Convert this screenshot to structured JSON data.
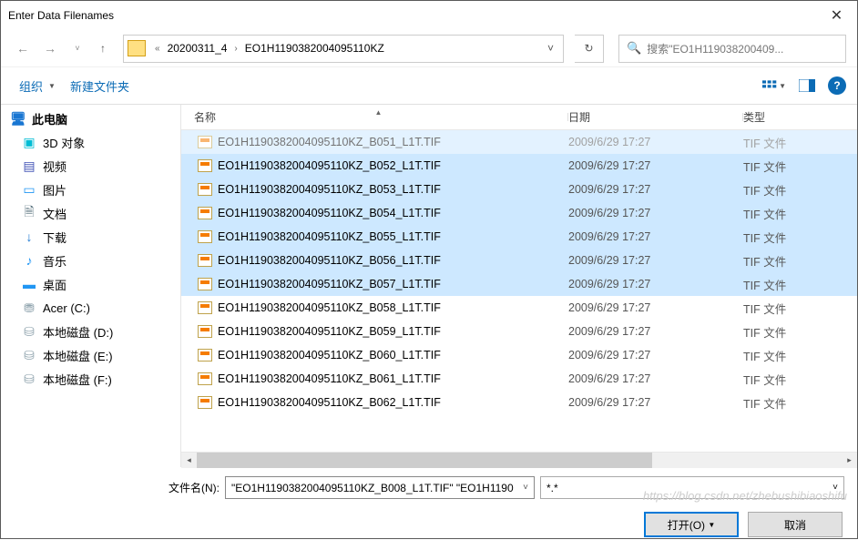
{
  "title": "Enter Data Filenames",
  "breadcrumb": {
    "pre": "«",
    "seg1": "20200311_4",
    "seg2": "EO1H1190382004095110KZ"
  },
  "search": {
    "placeholder": "搜索\"EO1H119038200409..."
  },
  "toolbar": {
    "organize": "组织",
    "newfolder": "新建文件夹"
  },
  "columns": {
    "name": "名称",
    "date": "日期",
    "type": "类型"
  },
  "tree": {
    "root": "此电脑",
    "items": [
      {
        "label": "3D 对象",
        "icon": "ic-3d",
        "glyph": "▣"
      },
      {
        "label": "视频",
        "icon": "ic-video",
        "glyph": "▤"
      },
      {
        "label": "图片",
        "icon": "ic-pic",
        "glyph": "▭"
      },
      {
        "label": "文档",
        "icon": "ic-doc",
        "glyph": "🗎"
      },
      {
        "label": "下载",
        "icon": "ic-dl",
        "glyph": "↓"
      },
      {
        "label": "音乐",
        "icon": "ic-music",
        "glyph": "♪"
      },
      {
        "label": "桌面",
        "icon": "ic-desk",
        "glyph": "▬"
      },
      {
        "label": "Acer (C:)",
        "icon": "ic-drive",
        "glyph": "⛃"
      },
      {
        "label": "本地磁盘 (D:)",
        "icon": "ic-drive",
        "glyph": "⛁"
      },
      {
        "label": "本地磁盘 (E:)",
        "icon": "ic-drive",
        "glyph": "⛁"
      },
      {
        "label": "本地磁盘 (F:)",
        "icon": "ic-drive",
        "glyph": "⛁"
      }
    ]
  },
  "files": [
    {
      "name": "EO1H1190382004095110KZ_B051_L1T.TIF",
      "date": "2009/6/29 17:27",
      "type": "TIF 文件",
      "sel": true,
      "cut": true
    },
    {
      "name": "EO1H1190382004095110KZ_B052_L1T.TIF",
      "date": "2009/6/29 17:27",
      "type": "TIF 文件",
      "sel": true
    },
    {
      "name": "EO1H1190382004095110KZ_B053_L1T.TIF",
      "date": "2009/6/29 17:27",
      "type": "TIF 文件",
      "sel": true
    },
    {
      "name": "EO1H1190382004095110KZ_B054_L1T.TIF",
      "date": "2009/6/29 17:27",
      "type": "TIF 文件",
      "sel": true
    },
    {
      "name": "EO1H1190382004095110KZ_B055_L1T.TIF",
      "date": "2009/6/29 17:27",
      "type": "TIF 文件",
      "sel": true
    },
    {
      "name": "EO1H1190382004095110KZ_B056_L1T.TIF",
      "date": "2009/6/29 17:27",
      "type": "TIF 文件",
      "sel": true
    },
    {
      "name": "EO1H1190382004095110KZ_B057_L1T.TIF",
      "date": "2009/6/29 17:27",
      "type": "TIF 文件",
      "sel": true
    },
    {
      "name": "EO1H1190382004095110KZ_B058_L1T.TIF",
      "date": "2009/6/29 17:27",
      "type": "TIF 文件",
      "sel": false
    },
    {
      "name": "EO1H1190382004095110KZ_B059_L1T.TIF",
      "date": "2009/6/29 17:27",
      "type": "TIF 文件",
      "sel": false
    },
    {
      "name": "EO1H1190382004095110KZ_B060_L1T.TIF",
      "date": "2009/6/29 17:27",
      "type": "TIF 文件",
      "sel": false
    },
    {
      "name": "EO1H1190382004095110KZ_B061_L1T.TIF",
      "date": "2009/6/29 17:27",
      "type": "TIF 文件",
      "sel": false
    },
    {
      "name": "EO1H1190382004095110KZ_B062_L1T.TIF",
      "date": "2009/6/29 17:27",
      "type": "TIF 文件",
      "sel": false
    }
  ],
  "footer": {
    "fnlabel": "文件名(N):",
    "fnvalue": "\"EO1H1190382004095110KZ_B008_L1T.TIF\" \"EO1H1190",
    "filter": "*.*",
    "open": "打开(O)",
    "cancel": "取消"
  },
  "watermark": "https://blog.csdn.net/zhebushibiaoshifu"
}
